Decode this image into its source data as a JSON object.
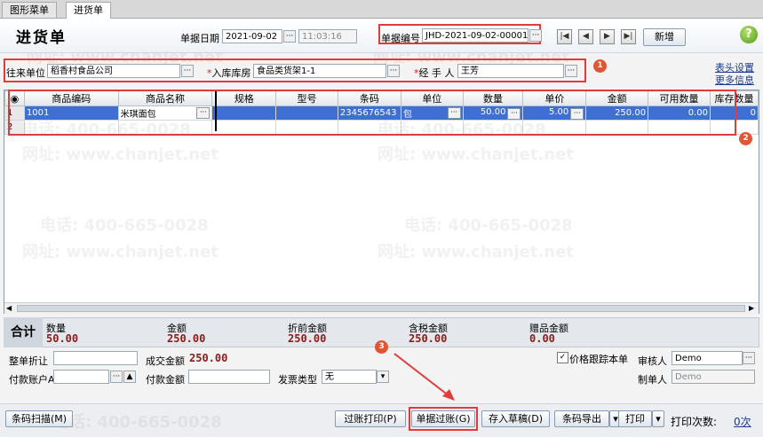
{
  "tabs": [
    {
      "label": "图形菜单"
    },
    {
      "label": "进货单"
    }
  ],
  "title": "进货单",
  "header": {
    "date_label": "单据日期",
    "date_value": "2021-09-02",
    "time_value": "11:03:16",
    "docno_label": "单据编号",
    "docno_value": "JHD-2021-09-02-00001",
    "new_button": "新增"
  },
  "fields": {
    "supplier_label": "往来单位",
    "supplier_value": "稻香村食品公司",
    "warehouse_label": "入库库房",
    "warehouse_value": "食品类货架1-1",
    "handler_label": "经 手 人",
    "handler_value": "王芳"
  },
  "links": {
    "header_settings": "表头设置",
    "more_info": "更多信息"
  },
  "badges": [
    "1",
    "2",
    "3"
  ],
  "grid": {
    "columns": [
      "商品编码",
      "商品名称",
      "规格",
      "型号",
      "条码",
      "单位",
      "数量",
      "单价",
      "金额",
      "可用数量",
      "库存数量"
    ],
    "rows": [
      {
        "no": "1",
        "code": "1001",
        "name": "米琪面包",
        "spec": "",
        "model": "",
        "barcode": "2345676543",
        "unit": "包",
        "qty": "50.00",
        "price": "5.00",
        "amount": "250.00",
        "avail": "0.00",
        "stock": "0"
      },
      {
        "no": "2",
        "code": "",
        "name": "",
        "spec": "",
        "model": "",
        "barcode": "",
        "unit": "",
        "qty": "",
        "price": "",
        "amount": "",
        "avail": "",
        "stock": ""
      }
    ]
  },
  "totals": {
    "label": "合计",
    "items": [
      {
        "name": "数量",
        "value": "50.00"
      },
      {
        "name": "金额",
        "value": "250.00"
      },
      {
        "name": "折前金额",
        "value": "250.00"
      },
      {
        "name": "含税金额",
        "value": "250.00"
      },
      {
        "name": "赠品金额",
        "value": "0.00"
      }
    ]
  },
  "form": {
    "discount_label": "整单折让",
    "deal_amount_label": "成交金额",
    "deal_amount_value": "250.00",
    "track_price_label": "价格跟踪本单",
    "auditor_label": "审核人",
    "auditor_value": "Demo",
    "pay_account_label": "付款账户A",
    "pay_amount_label": "付款金额",
    "invoice_type_label": "发票类型",
    "invoice_type_value": "无",
    "maker_label": "制单人",
    "maker_value": "Demo"
  },
  "bottom": {
    "barcode_scan": "条码扫描(M)",
    "post_print": "过账打印(P)",
    "post": "单据过账(G)",
    "save_draft": "存入草稿(D)",
    "barcode_export": "条码导出",
    "print": "打印",
    "print_count_label": "打印次数:",
    "print_count_value": "0次"
  },
  "watermark": {
    "phone": "电话: 400-665-0028",
    "site": "网址: www.chanjet.net"
  }
}
